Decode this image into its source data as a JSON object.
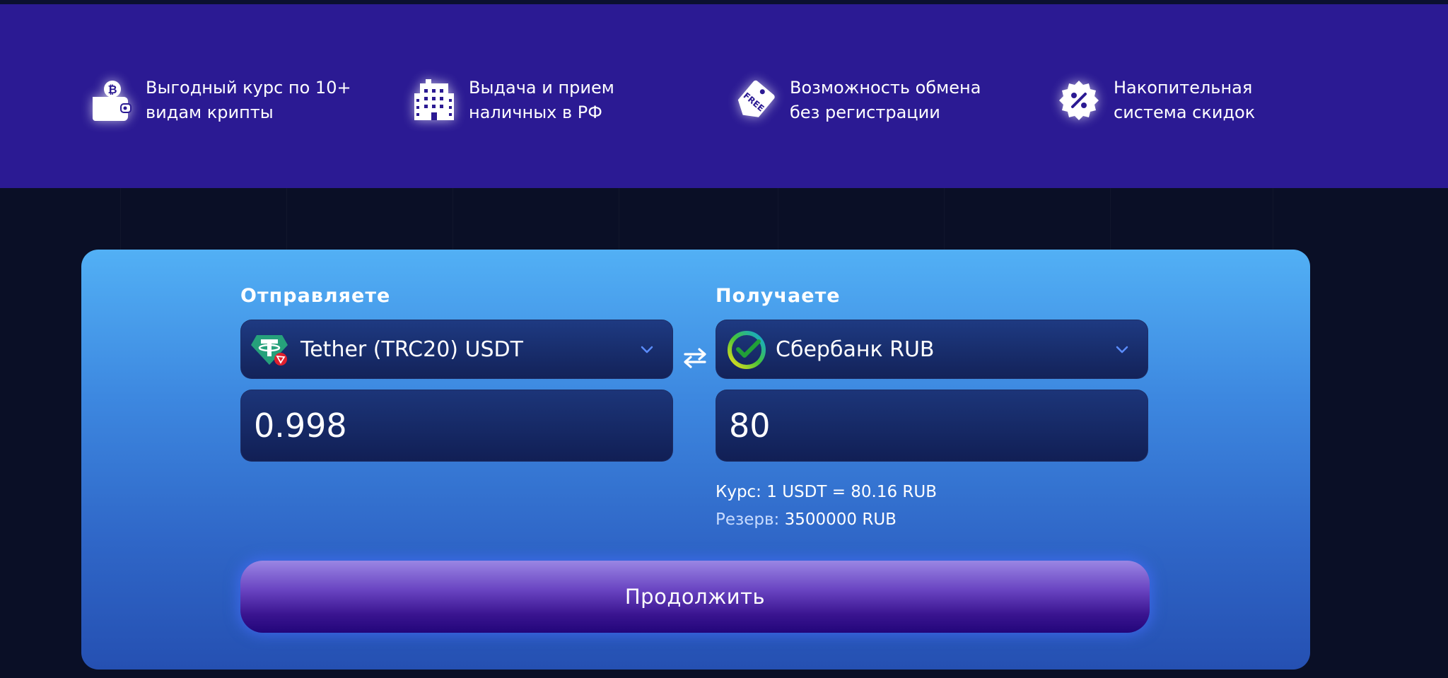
{
  "features": [
    {
      "icon": "bitcoin-wallet-icon",
      "text": "Выгодный курс по 10+\nвидам крипты"
    },
    {
      "icon": "building-icon",
      "text": "Выдача и прием\nналичных в РФ"
    },
    {
      "icon": "free-tag-icon",
      "text": "Возможность обмена\nбез регистрации"
    },
    {
      "icon": "discount-badge-icon",
      "text": "Накопительная\nсистема скидок"
    }
  ],
  "exchange": {
    "send_label": "Отправляете",
    "receive_label": "Получаете",
    "send_currency": {
      "name": "Tether (TRC20) USDT",
      "icon": "tether-trc20-icon"
    },
    "receive_currency": {
      "name": "Сбербанк RUB",
      "icon": "sberbank-icon"
    },
    "send_amount": "0.998",
    "receive_amount": "80",
    "rate_text": "Курс: 1 USDT = 80.16 RUB",
    "reserve_label": "Резерв:",
    "reserve_value": "3500000 RUB",
    "continue_label": "Продолжить"
  },
  "colors": {
    "feature_band": "#2b1a93",
    "page_background": "#0a0f26",
    "card_top": "#52b0f5",
    "card_bottom": "#2550b2",
    "field_background": "#132259",
    "accent_chevron": "#5b8dff",
    "button_gradient_top": "#9a86e4",
    "button_gradient_bottom": "#22067a"
  }
}
